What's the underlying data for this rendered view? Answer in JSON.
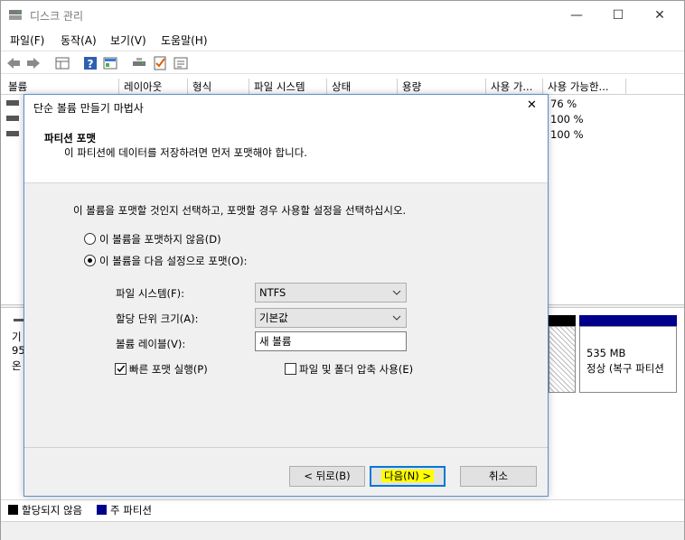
{
  "window": {
    "title": "디스크 관리",
    "minimize": "—",
    "maximize": "☐",
    "close": "✕"
  },
  "menu": [
    "파일(F)",
    "동작(A)",
    "보기(V)",
    "도움말(H)"
  ],
  "columns": [
    "볼륨",
    "레이아웃",
    "형식",
    "파일 시스템",
    "상태",
    "용량",
    "사용 가...",
    "사용 가능한..."
  ],
  "volume_free_pct": [
    "76 %",
    "100 %",
    "100 %"
  ],
  "disk_panel": {
    "label_lines": [
      "기",
      "95",
      "온"
    ],
    "partition_size": "535 MB",
    "partition_status": "정상 (복구 파티션"
  },
  "legend": [
    {
      "label": "할당되지 않음",
      "color": "#000000"
    },
    {
      "label": "주 파티션",
      "color": "#00008b"
    }
  ],
  "dialog": {
    "title": "단순 볼륨 만들기 마법사",
    "close": "✕",
    "header_title": "파티션 포맷",
    "header_desc": "이 파티션에 데이터를 저장하려면 먼저 포맷해야 합니다.",
    "instruction": "이 볼륨을 포맷할 것인지 선택하고, 포맷할 경우 사용할 설정을 선택하십시오.",
    "radio_no_format": "이 볼륨을 포맷하지 않음(D)",
    "radio_format": "이 볼륨을 다음 설정으로 포맷(O):",
    "fs_label": "파일 시스템(F):",
    "fs_value": "NTFS",
    "alloc_label": "할당 단위 크기(A):",
    "alloc_value": "기본값",
    "vol_label": "볼륨 레이블(V):",
    "vol_value": "새 볼륨",
    "quick_format": "빠른 포맷 실행(P)",
    "compression": "파일 및 폴더 압축 사용(E)",
    "back": "< 뒤로(B)",
    "next": "다음(N) >",
    "cancel": "취소"
  },
  "colors": {
    "highlight": "#ffff00",
    "accent": "#0078d7",
    "primary_partition": "#00008b"
  }
}
